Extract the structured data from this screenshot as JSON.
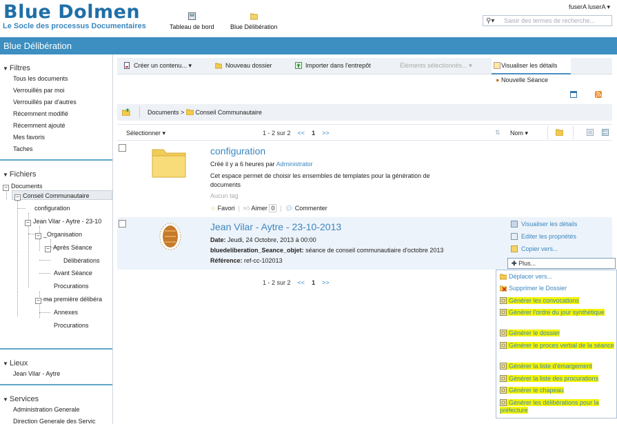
{
  "header": {
    "logo_title": "Blue Dolmen",
    "logo_subtitle": "Le Socle des processus Documentaires",
    "nav": [
      {
        "label": "Tableau de bord",
        "icon": "dashboard-icon"
      },
      {
        "label": "Blue Délibération",
        "icon": "folder-icon"
      }
    ],
    "user": "fuserA luserA ▾",
    "search_placeholder": "Saisir des termes de recherche..."
  },
  "page_title": "Blue Délibération",
  "sidebar": {
    "filtres": {
      "title": "Filtres",
      "items": [
        "Tous les documents",
        "Verrouillés par moi",
        "Verrouillés par d'autres",
        "Récemment modifié",
        "Récemment ajouté",
        "Mes favoris",
        "Taches"
      ]
    },
    "fichiers": {
      "title": "Fichiers",
      "tree": [
        "Documents",
        "Conseil Communautaire",
        "configuration",
        "Jean Vilar - Aytre - 23-10",
        "_Organisation",
        "Après Séance",
        "Délibérations",
        "Avant Séance",
        "Procurations",
        "ma première délibéra",
        "Annexes",
        "Procurations"
      ]
    },
    "lieux": {
      "title": "Lieux",
      "items": [
        "Jean Vilar - Aytre"
      ]
    },
    "services": {
      "title": "Services",
      "items": [
        "Administration Generale",
        "Direction Generale des Servic"
      ]
    }
  },
  "toolbar": {
    "create": "Créer un contenu...",
    "new_folder": "Nouveau dossier",
    "import": "Importer dans l'entrepôt",
    "selected": "Éléments sélectionnés...",
    "details_tab": "Visualiser les détails",
    "new_session": "Nouvelle Séance"
  },
  "breadcrumb": {
    "root": "Documents",
    "sep": ">",
    "current": "Conseil Communautaire"
  },
  "list": {
    "select_label": "Sélectionner ▾",
    "pager": {
      "range": "1 - 2 sur 2",
      "first": "<<",
      "page": "1",
      "next": ">>"
    },
    "sort_label": "Nom ▾"
  },
  "items": [
    {
      "title": "configuration",
      "created_prefix": "Créé il y a 6 heures par",
      "author": "Administrator",
      "description_line1": "Cet espace permet de choisir les ensembles de templates pour la génération de",
      "description_line2": "documents",
      "tags": "Aucun tag",
      "fav": "Favori",
      "like": "Aimer",
      "like_count": "0",
      "comment": "Commenter"
    },
    {
      "title": "Jean Vilar - Aytre - 23-10-2013",
      "date_label": "Date:",
      "date": "Jeudi, 24 Octobre, 2013 à 00:00",
      "objet_label": "bluedeliberation_Seance_objet:",
      "objet": "séance de conseil communautiaire d'octobre 2013",
      "ref_label": "Référence:",
      "ref": "ref-cc-102013"
    }
  ],
  "actions": [
    "Visualiser les détails",
    "Editer les propriétés",
    "Copier vers...",
    "Plus..."
  ],
  "more_menu": [
    {
      "label": "Déplacer vers...",
      "hl": false
    },
    {
      "label": "Supprimer le Dossier",
      "hl": false
    },
    {
      "label": "Générer les convocations",
      "hl": true
    },
    {
      "label": "Générer l'ordre du jour synthétique",
      "hl": true
    },
    {
      "label": "Générer le dossier",
      "hl": true
    },
    {
      "label": "Générer le proces verbal de la séance",
      "hl": true
    },
    {
      "label": "Générer la liste d'émargement",
      "hl": true
    },
    {
      "label": "Générer la liste des procurations",
      "hl": true
    },
    {
      "label": "Générer le chapeau",
      "hl": true
    },
    {
      "label": "Générer les délibérations pour la préfecture",
      "hl": true
    }
  ],
  "colors": {
    "brand": "#1f6fa8",
    "titlebar": "#3c8fc0",
    "link": "#3a86bf",
    "highlight": "#f4f400"
  }
}
